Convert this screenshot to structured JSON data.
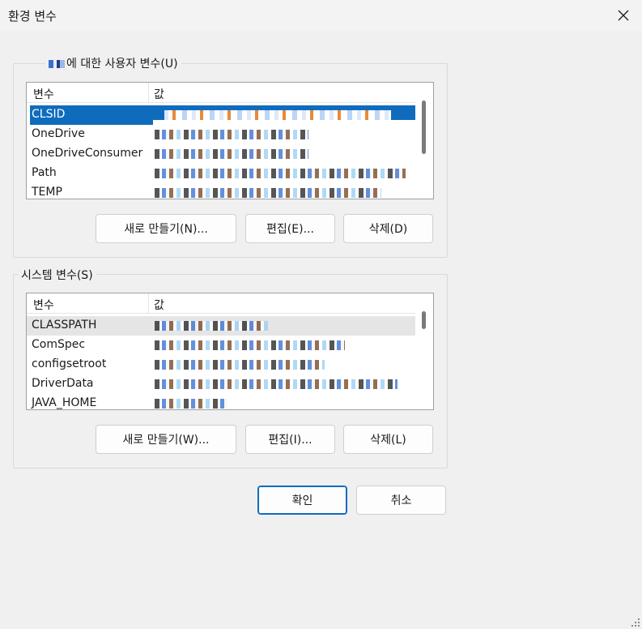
{
  "window": {
    "title": "환경 변수",
    "close_icon": "close-icon"
  },
  "user_group": {
    "label_suffix": "에 대한 사용자 변수(U)",
    "columns": [
      "변수",
      "값"
    ],
    "rows": [
      {
        "name": "CLSID",
        "selected": true
      },
      {
        "name": "OneDrive"
      },
      {
        "name": "OneDriveConsumer"
      },
      {
        "name": "Path"
      },
      {
        "name": "TEMP"
      }
    ],
    "buttons": {
      "new": "새로 만들기(N)...",
      "edit": "편집(E)...",
      "delete": "삭제(D)"
    }
  },
  "system_group": {
    "label": "시스템 변수(S)",
    "columns": [
      "변수",
      "값"
    ],
    "rows": [
      {
        "name": "CLASSPATH",
        "hover": true
      },
      {
        "name": "ComSpec"
      },
      {
        "name": "configsetroot"
      },
      {
        "name": "DriverData"
      },
      {
        "name": "JAVA_HOME"
      }
    ],
    "buttons": {
      "new": "새로 만들기(W)...",
      "edit": "편집(I)...",
      "delete": "삭제(L)"
    }
  },
  "footer": {
    "ok": "확인",
    "cancel": "취소"
  },
  "colors": {
    "accent": "#0f6cbd",
    "background": "#f0f0f0"
  }
}
